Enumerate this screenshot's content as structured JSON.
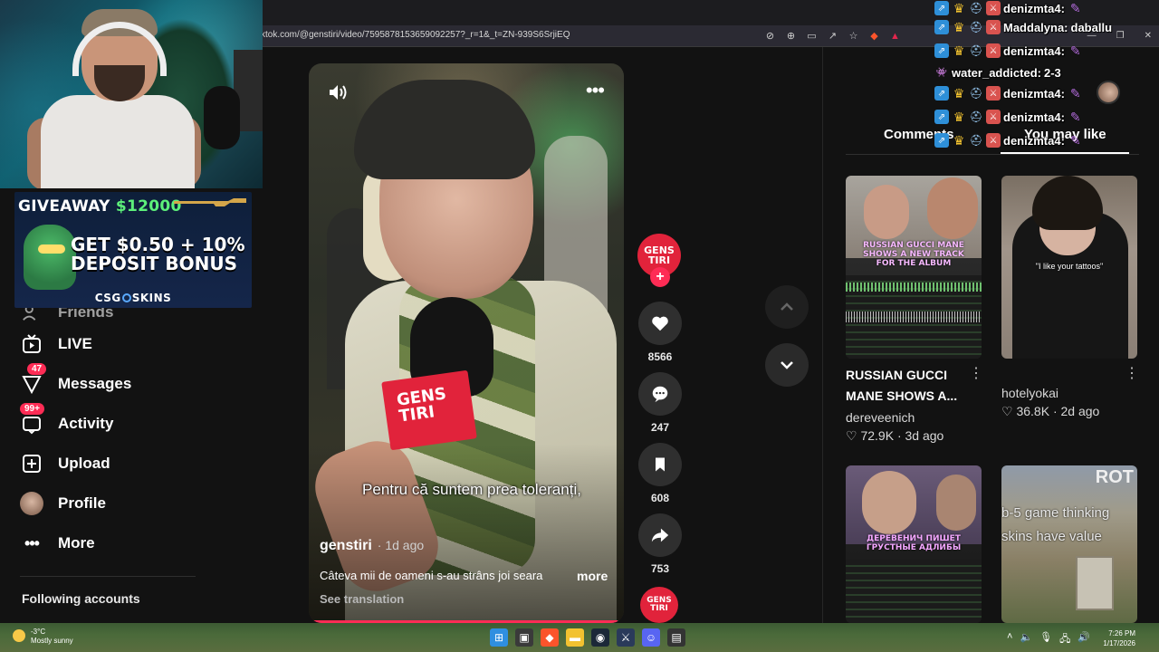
{
  "browser": {
    "url": "ktok.com/@genstiri/video/7595878153659092257?_r=1&_t=ZN-939S6SrjiEQ"
  },
  "promo": {
    "title": "GIVEAWAY",
    "amount": "$12000",
    "line1": "GET $0.50 + 10%",
    "line2": "DEPOSIT BONUS",
    "brand_left": "CSG",
    "brand_right": "SKINS"
  },
  "sidebar": {
    "partial_item": "Friends",
    "items": [
      {
        "label": "LIVE",
        "icon": "live-tv-icon"
      },
      {
        "label": "Messages",
        "icon": "messages-icon",
        "badge": "47"
      },
      {
        "label": "Activity",
        "icon": "activity-icon",
        "badge": "99+"
      },
      {
        "label": "Upload",
        "icon": "upload-icon"
      },
      {
        "label": "Profile",
        "icon": "profile-avatar"
      },
      {
        "label": "More",
        "icon": "more-icon"
      }
    ],
    "following_title": "Following accounts"
  },
  "video": {
    "caption": "Pentru că suntem prea toleranți,",
    "author": "genstiri",
    "time": "· 1d ago",
    "description": "Câteva mii de oameni s-au strâns joi seara",
    "more_label": "more",
    "translate_label": "See translation",
    "mic_flag_text": "GENS TIRI",
    "progress": 0.98
  },
  "actions": {
    "creator_logo": "GENS TIRI",
    "likes": "8566",
    "comments": "247",
    "saves": "608",
    "shares": "753",
    "music_logo": "GENS TIRI"
  },
  "right_panel": {
    "tabs": [
      "Comments",
      "You may like"
    ],
    "active_tab": "You may like",
    "cards": [
      {
        "title": "RUSSIAN GUCCI MANE SHOWS A...",
        "author": "dereveenich",
        "likes": "72.9K",
        "age": "3d ago",
        "thumb_text": "RUSSIAN GUCCI MANE SHOWS A NEW TRACK FOR THE ALBUM"
      },
      {
        "title": "",
        "author": "hotelyokai",
        "likes": "36.8K",
        "age": "2d ago",
        "thumb_text": "\"I like your tattoos\""
      },
      {
        "thumb_text": "ДЕРЕВЕНИЧ ПИШЕТ ГРУСТНЫЕ АДЛИБЫ"
      },
      {
        "thumb_text_top": "ROT",
        "thumb_text": "b-5 game thinking skins have value"
      }
    ]
  },
  "chat": {
    "lines": [
      {
        "user": "denizmta4:",
        "msg": "",
        "color": "#ffffff"
      },
      {
        "user": "Maddalyna:",
        "msg": "daballu",
        "color": "#ffffff"
      },
      {
        "user": "denizmta4:",
        "msg": "",
        "color": "#ffffff"
      },
      {
        "user": "water_addicted:",
        "msg": "2-3",
        "color": "#ffffff"
      },
      {
        "user": "denizmta4:",
        "msg": "",
        "color": "#ffffff"
      },
      {
        "user": "denizmta4:",
        "msg": "",
        "color": "#ffffff"
      },
      {
        "user": "denizmta4:",
        "msg": "",
        "color": "#ffffff"
      }
    ]
  },
  "taskbar": {
    "temperature": "-3°C",
    "weather": "Mostly sunny",
    "time": "7:26 PM",
    "date": "1/17/2026"
  }
}
